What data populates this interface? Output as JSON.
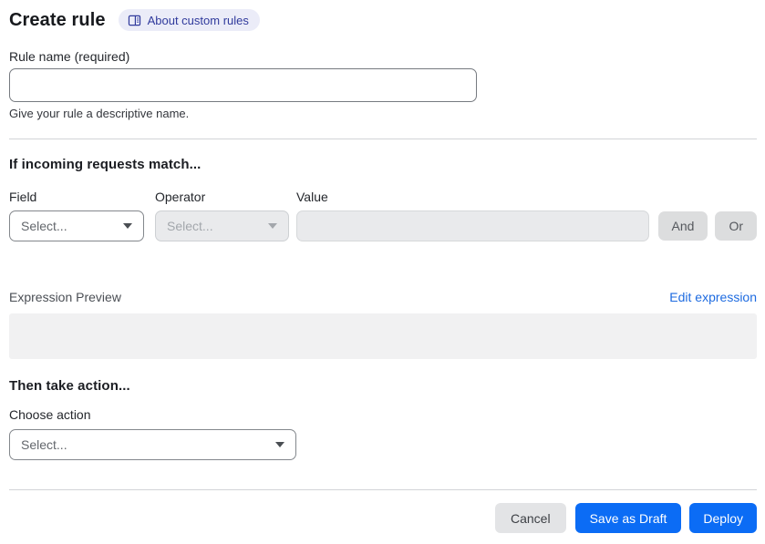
{
  "header": {
    "title": "Create rule",
    "about_badge": {
      "label": "About custom rules",
      "icon": "book-icon"
    }
  },
  "rule_name": {
    "label": "Rule name (required)",
    "value": "",
    "placeholder": "",
    "helper": "Give your rule a descriptive name."
  },
  "match_section": {
    "heading": "If incoming requests match...",
    "field": {
      "label": "Field",
      "selected": "Select...",
      "disabled": false
    },
    "operator": {
      "label": "Operator",
      "selected": "Select...",
      "disabled": true
    },
    "value": {
      "label": "Value",
      "value": "",
      "disabled": true
    },
    "and_button": "And",
    "or_button": "Or"
  },
  "expression": {
    "label": "Expression Preview",
    "edit_link": "Edit expression",
    "content": ""
  },
  "action_section": {
    "heading": "Then take action...",
    "choose_label": "Choose action",
    "selected": "Select..."
  },
  "footer": {
    "cancel": "Cancel",
    "save_draft": "Save as Draft",
    "deploy": "Deploy"
  },
  "colors": {
    "primary_blue": "#0b6cf5",
    "link_blue": "#1e6be0",
    "badge_bg": "#ebecf8",
    "badge_text": "#303a9c",
    "disabled_bg": "#e9eaec",
    "neutral_button_bg": "#dcddde",
    "preview_bg": "#f1f1f2",
    "divider": "#d2d4d7"
  }
}
